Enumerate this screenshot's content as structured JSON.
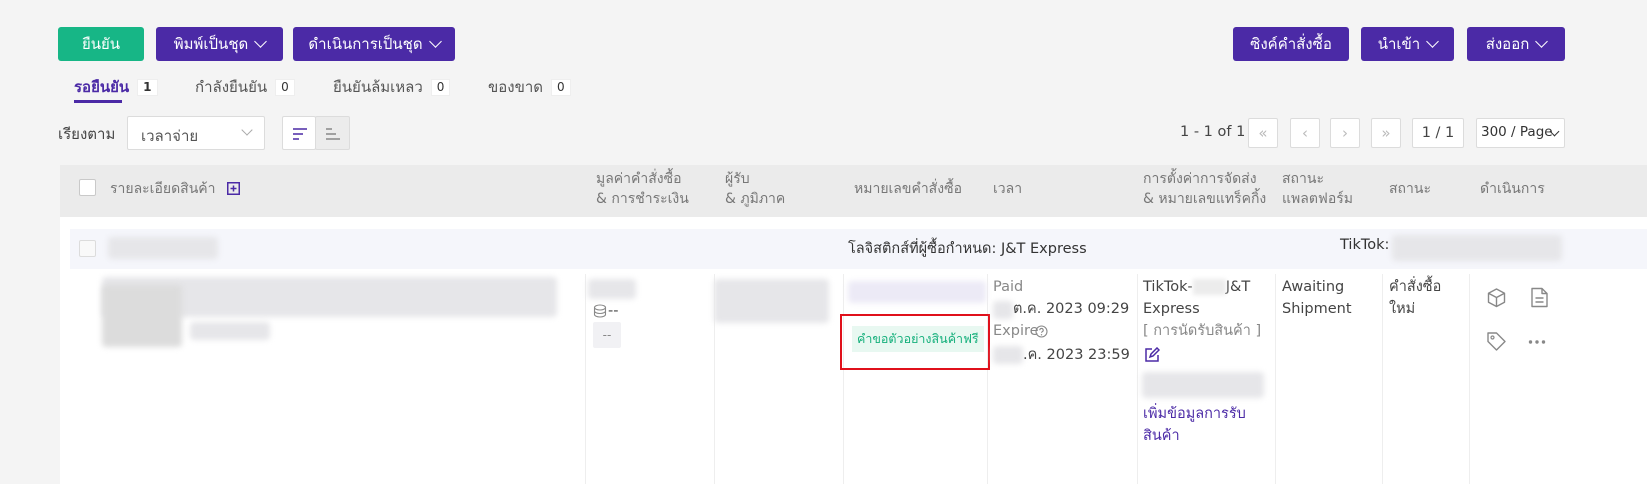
{
  "toolbar": {
    "confirm": "ยืนยัน",
    "batch_print": "พิมพ์เป็นชุด",
    "batch_process": "ดำเนินการเป็นชุด",
    "sync_orders": "ซิงค์คำสั่งซื้อ",
    "import": "นำเข้า",
    "export": "ส่งออก"
  },
  "tabs": [
    {
      "label": "รอยืนยัน",
      "count": "1"
    },
    {
      "label": "กำลังยืนยัน",
      "count": "0"
    },
    {
      "label": "ยืนยันล้มเหลว",
      "count": "0"
    },
    {
      "label": "ของขาด",
      "count": "0"
    }
  ],
  "sort": {
    "label": "เรียงตาม",
    "value": "เวลาจ่าย"
  },
  "pagination": {
    "range": "1 - 1 of 1",
    "page": "1 / 1",
    "per_page": "300 / Page"
  },
  "columns": {
    "product": "รายละเอียดสินค้า",
    "value_l1": "มูลค่าคำสั่งซื้อ",
    "value_l2": "& การชำระเงิน",
    "recipient_l1": "ผู้รับ",
    "recipient_l2": "& ภูมิภาค",
    "order_no": "หมายเลขคำสั่งซื้อ",
    "time": "เวลา",
    "shipping_l1": "การตั้งค่าการจัดส่ง",
    "shipping_l2": "& หมายเลขแทร็คกิ้ง",
    "platform_l1": "สถานะ",
    "platform_l2": "แพลตฟอร์ม",
    "status": "สถานะ",
    "actions": "ดำเนินการ"
  },
  "order": {
    "logistics": "โลจิสติกส์ที่ผู้ซื้อกำหนด: J&T Express",
    "store": "TikTok: ",
    "payment_dash": "--",
    "payment_badge": "--",
    "free_sample_tag": "คำขอตัวอย่างสินค้าฟรี",
    "paid_label": "Paid",
    "paid_time": "ต.ค. 2023 09:29",
    "expire_label": "Expire",
    "expire_time": ".ค. 2023 23:59",
    "shipping_l1a": "TikTok-",
    "shipping_l1b": "J&T",
    "shipping_l2": "Express",
    "pickup": "[ การนัดรับสินค้า ]",
    "add_pickup_l1": "เพิ่มข้อมูลการรับ",
    "add_pickup_l2": "สินค้า",
    "platform_status_l1": "Awaiting",
    "platform_status_l2": "Shipment",
    "status_l1": "คำสั่งซื้อ",
    "status_l2": "ใหม่"
  },
  "colors": {
    "primary": "#4b2aa6",
    "confirm": "#17b686",
    "highlight": "#e0101b",
    "tag_text": "#16b07c"
  }
}
